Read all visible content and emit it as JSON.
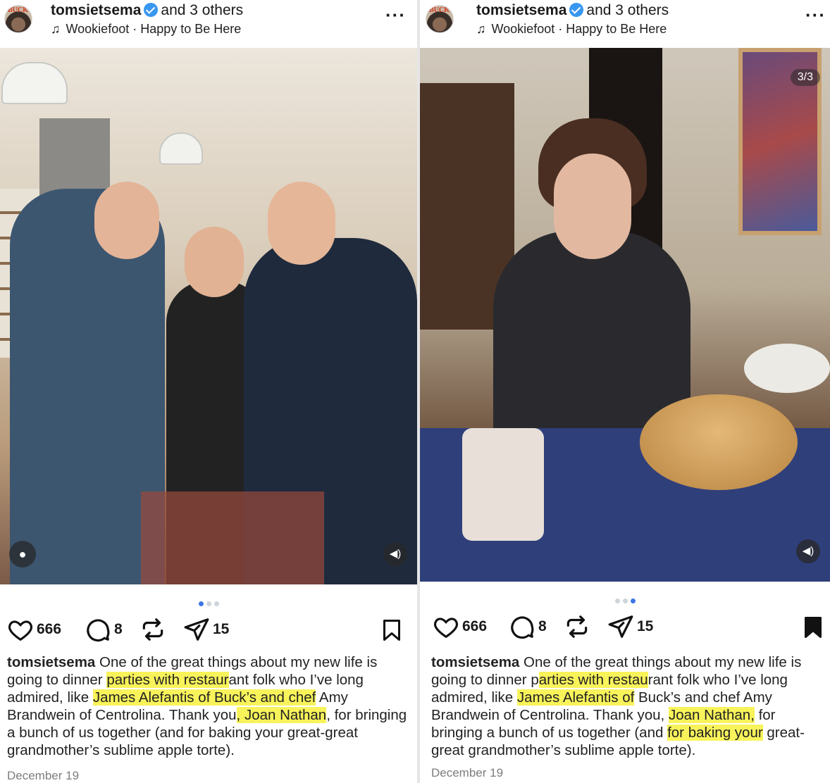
{
  "posts": [
    {
      "username": "tomsietsema",
      "others": "and 3 others",
      "music": "Wookiefoot · Happy to Be Here",
      "avatar_text": "BUCK",
      "counter": "",
      "likes": "666",
      "comments": "8",
      "shares": "15",
      "caption": {
        "user": "tomsietsema",
        "t1": " One of the great things about my new life is going to dinner ",
        "h1": "parties with restaur",
        "t2": "ant folk who I’ve long admired, like ",
        "h2": "James Alefantis of Buck’s and chef",
        "t3": " Amy Brandwein of Centrolina. Thank you",
        "h3": ", Joan Nathan",
        "t4": ", for bringing a bunch of us together (and for baking your great-great grandmother’s sublime apple torte)."
      },
      "date": "December 19",
      "carousel_index": 1,
      "bookmarked": false
    },
    {
      "username": "tomsietsema",
      "others": "and 3 others",
      "music": "Wookiefoot · Happy to Be Here",
      "avatar_text": "BUCK",
      "counter": "3/3",
      "likes": "666",
      "comments": "8",
      "shares": "15",
      "caption": {
        "user": "tomsietsema",
        "t1": " One of the great things about my new life is going to dinner p",
        "h1": "arties with restau",
        "t2": "rant folk who I’ve long admired, like ",
        "h2": "James Alefantis of",
        "t3": " Buck’s and chef Amy Brandwein of Centrolina. Thank you, ",
        "h3": "Joan Nathan,",
        "t4": " for bringing a bunch of us together (and ",
        "h4": "for baking your",
        "t5": " great-great grandmother’s sublime apple torte)."
      },
      "date": "December 19",
      "carousel_index": 3,
      "bookmarked": true
    }
  ],
  "icons": {
    "like": "heart-icon",
    "comment": "comment-icon",
    "repost": "repost-icon",
    "share": "send-icon",
    "save": "bookmark-icon",
    "music": "music-note-icon",
    "more": "more-icon",
    "user_tag": "user-tag-icon",
    "sound": "speaker-icon"
  },
  "colors": {
    "highlight": "#f8f35a",
    "verified": "#3897f0",
    "dot_active": "#3f74e8"
  }
}
